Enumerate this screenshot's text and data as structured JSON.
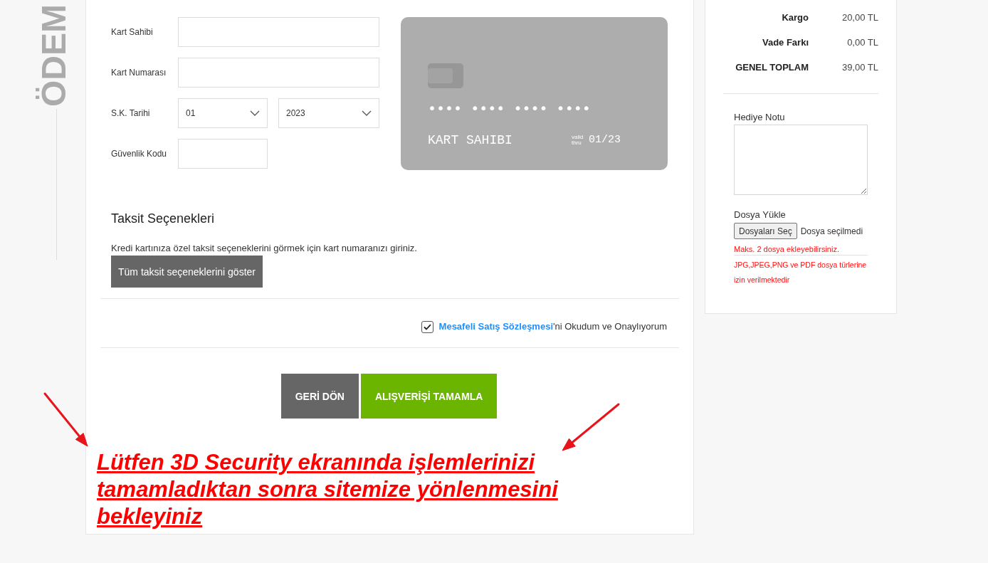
{
  "page_heading": "ÖDEM",
  "payment_form": {
    "fields": [
      {
        "kind": "text",
        "label": "Kart Sahibi"
      },
      {
        "kind": "text",
        "label": "Kart Numarası"
      },
      {
        "kind": "date",
        "label": "S.K. Tarihi",
        "selects": [
          "01",
          "2023"
        ]
      },
      {
        "kind": "short",
        "label": "Güvenlik Kodu"
      }
    ]
  },
  "card_preview": {
    "number": "•••• •••• •••• ••••",
    "holder": "KART SAHIBI",
    "expiry_caption": "valid thru",
    "expiry": "01/23"
  },
  "installments": {
    "title": "Taksit Seçenekleri",
    "description": "Kredi kartınıza özel taksit seçeneklerini görmek için kart numaranızı giriniz.",
    "button": "Tüm taksit seçeneklerini göster"
  },
  "agreement": {
    "checked": true,
    "link": "Mesafeli Satış Sözleşmesi",
    "text": "'ni Okudum ve Onaylıyorum"
  },
  "actions": [
    {
      "kind": "secondary",
      "label": "GERİ DÖN"
    },
    {
      "kind": "primary",
      "label": "ALIŞVERİŞİ TAMAMLA"
    }
  ],
  "notice": "Lütfen 3D Security ekranında işlemlerinizi tamamladıktan sonra sitemize yönlenmesini bekleyiniz",
  "summary": {
    "rows": [
      {
        "label": "Kargo",
        "value": "20,00 TL"
      },
      {
        "label": "Vade Farkı",
        "value": "0,00 TL"
      },
      {
        "label": "GENEL TOPLAM",
        "value": "39,00 TL"
      }
    ]
  },
  "gift_note": {
    "label": "Hediye Notu"
  },
  "file_upload": {
    "label": "Dosya Yükle",
    "button": "Dosyaları Seç",
    "status": "Dosya seçilmedi",
    "notes": [
      "Maks. 2 dosya ekleyebilirsiniz.",
      "JPG,JPEG,PNG ve PDF dosya türlerine izin verilmektedir"
    ]
  }
}
